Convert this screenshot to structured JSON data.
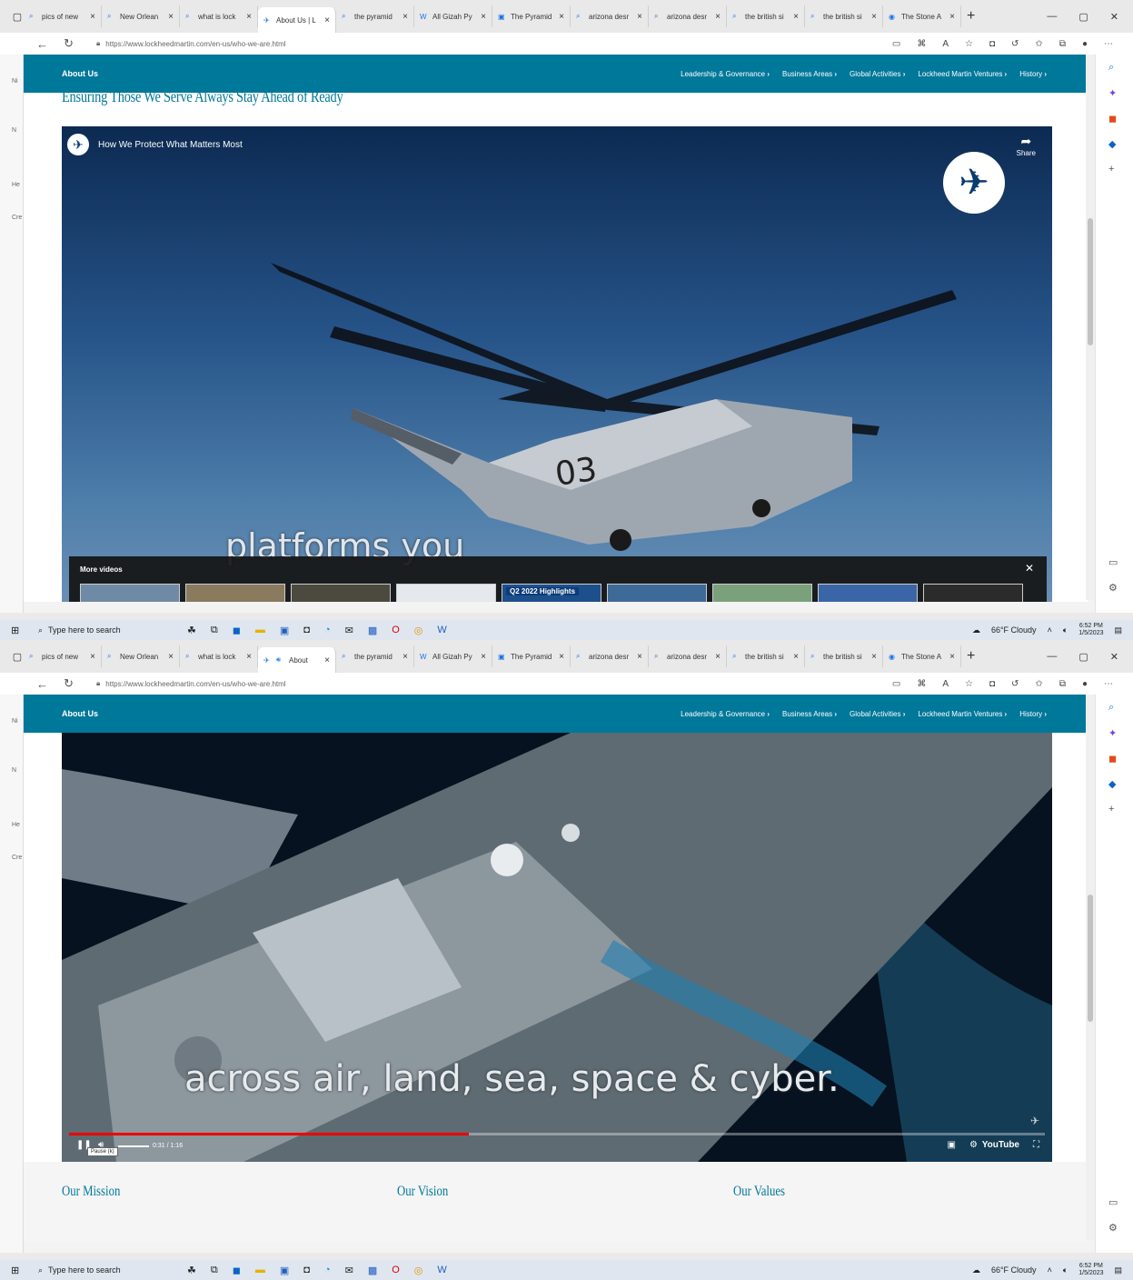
{
  "browser": {
    "tabs": [
      "pics of new",
      "New Orlean",
      "what is lock",
      "About Us | L",
      "the pyramid",
      "All Gizah Py",
      "The Pyramid",
      "arizona desr",
      "arizona desr",
      "the british si",
      "the british si",
      "The Stone A"
    ],
    "tabs_shot2_active": "About",
    "url": "https://www.lockheedmartin.com/en-us/who-we-are.html"
  },
  "site": {
    "nav_title": "About Us",
    "nav_links": [
      "Leadership & Governance",
      "Business Areas",
      "Global Activities",
      "Lockheed Martin Ventures",
      "History"
    ],
    "heading": "Ensuring Those We Serve Always Stay Ahead of Ready",
    "sections": [
      "Our Mission",
      "Our Vision",
      "Our Values"
    ]
  },
  "video": {
    "title": "How We Protect What Matters Most",
    "share_label": "Share",
    "caption1": "platforms you",
    "caption2": "across air, land, sea, space & cyber.",
    "more_videos_label": "More videos",
    "thumb_label": "Q2 2022 Highlights",
    "heli_number": "03",
    "time": "0:31 / 1:16",
    "progress": 0.41,
    "pause_tooltip": "Pause (k)",
    "youtube_label": "YouTube"
  },
  "taskbar": {
    "search_placeholder": "Type here to search",
    "weather": "66°F  Cloudy",
    "time": "6:52 PM",
    "date": "1/5/2023"
  },
  "colors": {
    "brand": "#00789a"
  }
}
